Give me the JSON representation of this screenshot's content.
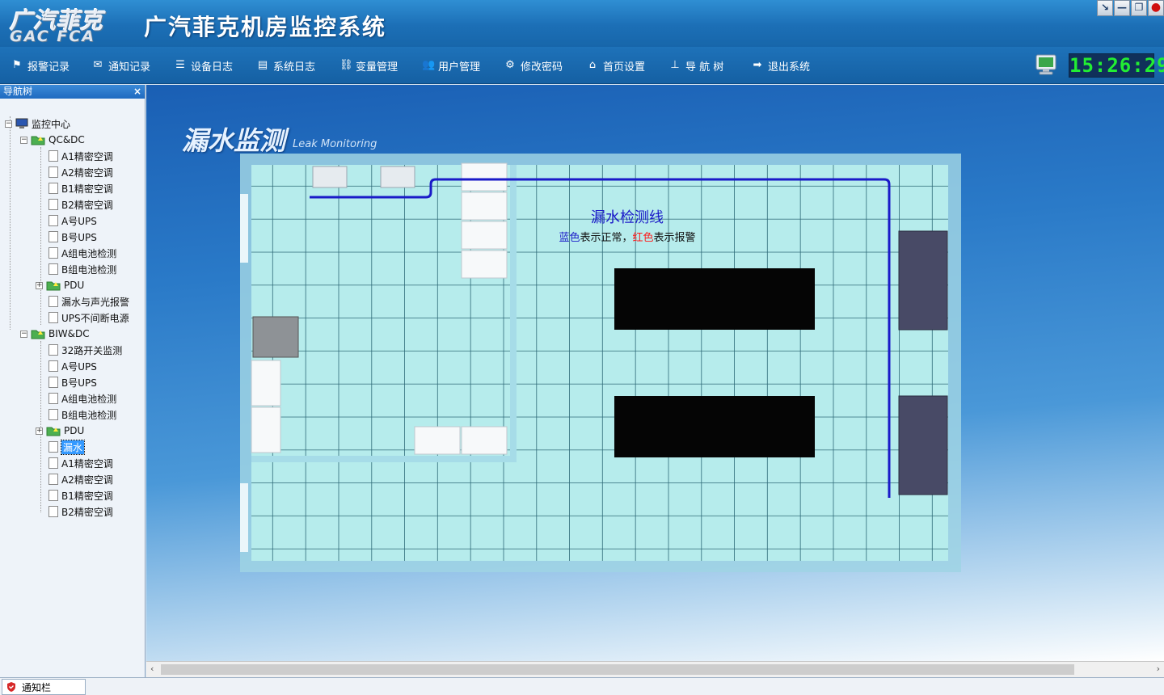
{
  "header": {
    "logo_cn": "广汽菲克",
    "logo_en": "GAC FCA",
    "title": "广汽菲克机房监控系统"
  },
  "window_controls": [
    "↘",
    "—",
    "❐",
    "●"
  ],
  "toolbar": {
    "items": [
      {
        "label": "报警记录",
        "icon": "flag-icon"
      },
      {
        "label": "通知记录",
        "icon": "mail-icon"
      },
      {
        "label": "设备日志",
        "icon": "list-icon"
      },
      {
        "label": "系统日志",
        "icon": "log-icon"
      },
      {
        "label": "变量管理",
        "icon": "link-icon"
      },
      {
        "label": "用户管理",
        "icon": "users-icon"
      },
      {
        "label": "修改密码",
        "icon": "gear-icon"
      },
      {
        "label": "首页设置",
        "icon": "home-icon"
      },
      {
        "label": "导 航 树",
        "icon": "tree-icon"
      },
      {
        "label": "退出系统",
        "icon": "exit-arrow-icon"
      }
    ],
    "clock": "15:26:29"
  },
  "nav": {
    "title": "导航树",
    "close": "×",
    "root": "监控中心",
    "groups": [
      {
        "name": "QC&DC",
        "items": [
          "A1精密空调",
          "A2精密空调",
          "B1精密空调",
          "B2精密空调",
          "A号UPS",
          "B号UPS",
          "A组电池检测",
          "B组电池检测",
          "PDU",
          "漏水与声光报警",
          "UPS不间断电源"
        ]
      },
      {
        "name": "BIW&DC",
        "items": [
          "32路开关监测",
          "A号UPS",
          "B号UPS",
          "A组电池检测",
          "B组电池检测",
          "PDU",
          "漏水",
          "A1精密空调",
          "A2精密空调",
          "B1精密空调",
          "B2精密空调"
        ]
      }
    ],
    "selected": "漏水"
  },
  "main": {
    "title": "漏水监测",
    "subtitle": "Leak Monitoring",
    "legend_title": "漏水检测线",
    "legend_blue": "蓝色",
    "legend_mid": "表示正常，",
    "legend_red": "红色",
    "legend_end": "表示报警",
    "line_color": "#1a1ac8",
    "normal_color": "#1a1ac8",
    "alarm_color": "#ff1a1a"
  },
  "statusbar": {
    "tab": "通知栏"
  }
}
